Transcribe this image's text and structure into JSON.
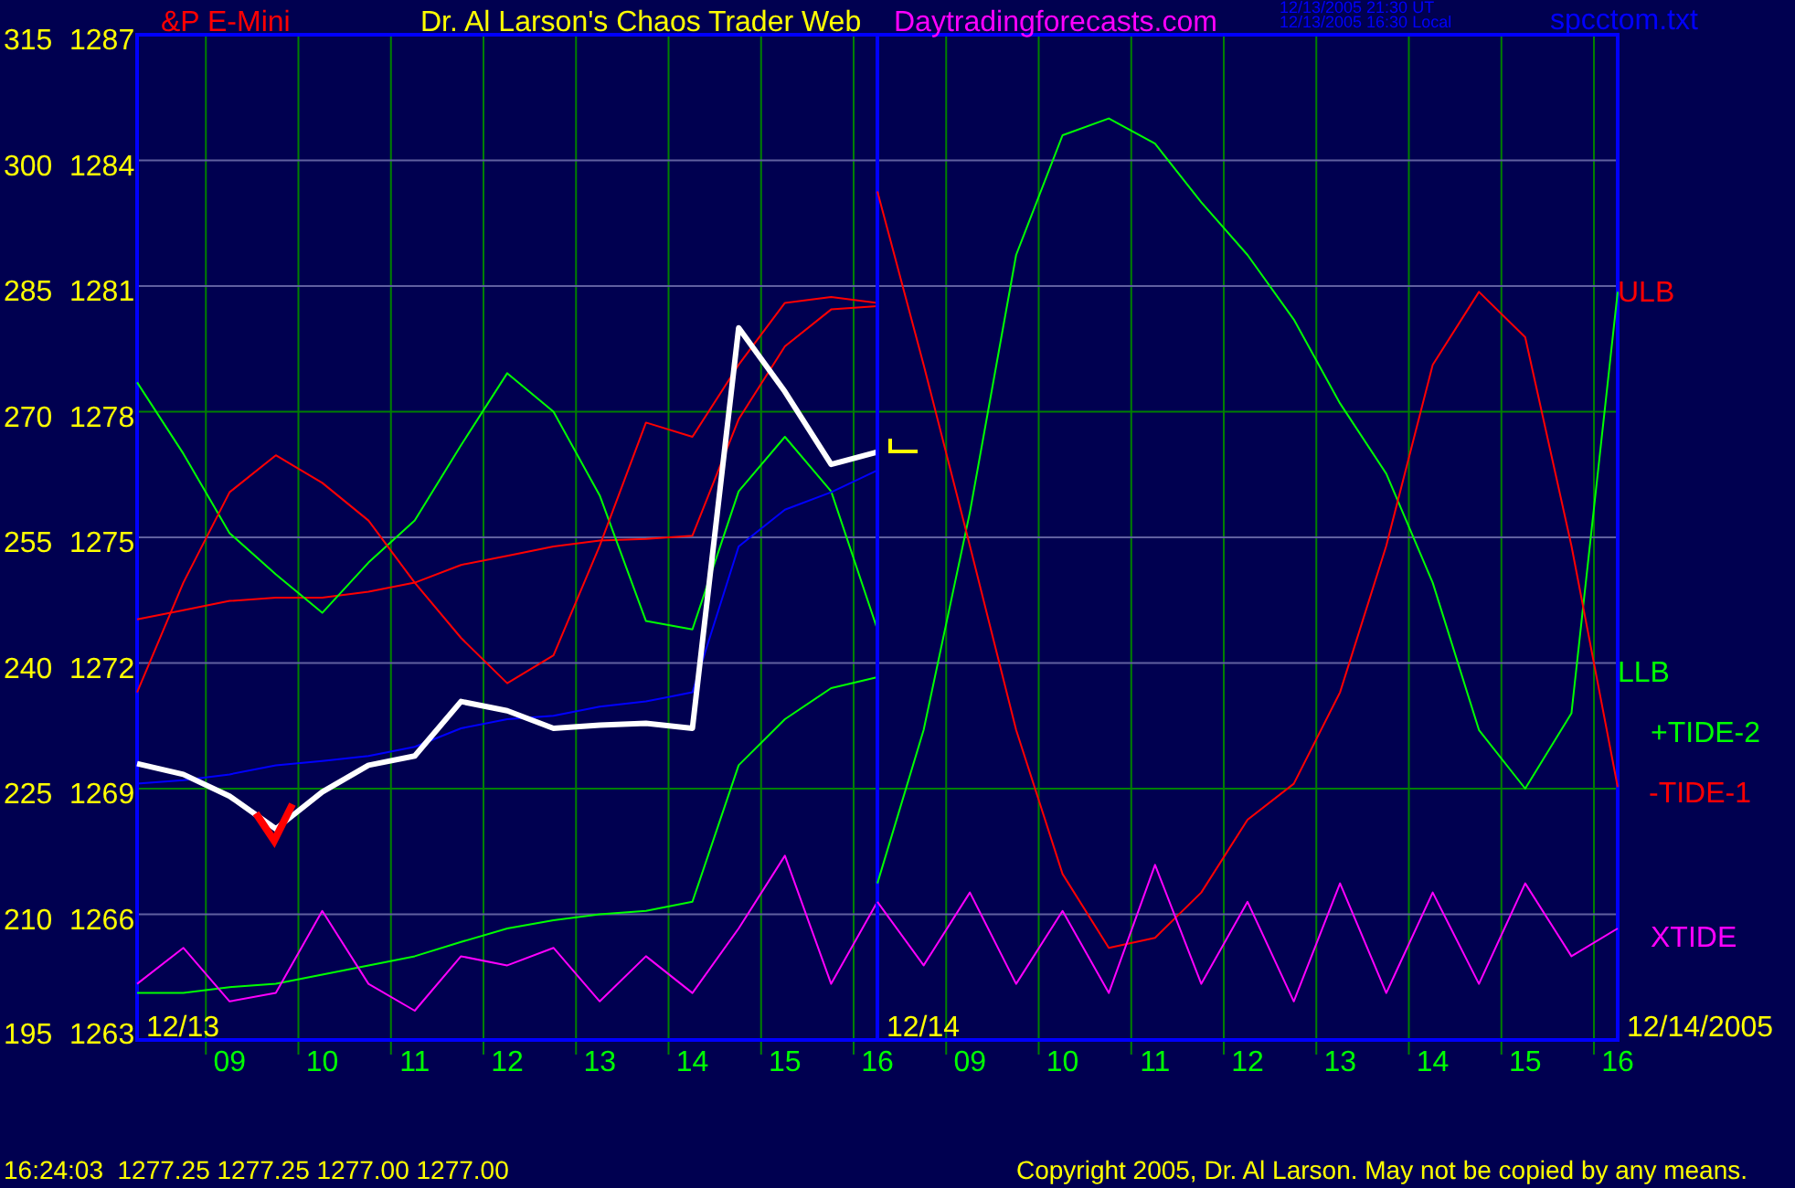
{
  "header": {
    "instrument": "&P E-Mini",
    "title": "Dr. Al Larson's Chaos Trader Web",
    "site": "Daytradingforecasts.com",
    "timestamps": [
      "12/13/2005 21:30 UT",
      "12/13/2005 16:30 Local"
    ],
    "file": "spcctom.txt"
  },
  "right_scale": [
    "1287",
    "1284",
    "1281",
    "1278",
    "1275",
    "1272",
    "1269",
    "1266",
    "1263"
  ],
  "legend": [
    {
      "label": "ULB",
      "color": "#ff0000"
    },
    {
      "label": "LLB",
      "color": "#00ff00"
    },
    {
      "label": "+TIDE-2",
      "color": "#00ff00"
    },
    {
      "label": "-TIDE-1",
      "color": "#ff0000"
    },
    {
      "label": "XTIDE",
      "color": "#ff00ff"
    }
  ],
  "panels": [
    {
      "date": "12/13",
      "chart_data": {
        "type": "line",
        "x": [
          8,
          8.5,
          9,
          9.5,
          10,
          10.5,
          11,
          11.5,
          12,
          12.5,
          13,
          13.5,
          14,
          14.5,
          15,
          15.5,
          16
        ],
        "xlim": [
          8,
          16
        ],
        "ylim": [
          195,
          315
        ],
        "grid": true,
        "xticks": [
          {
            "value": 9,
            "label": "09"
          },
          {
            "value": 10,
            "label": "10"
          },
          {
            "value": 11,
            "label": "11"
          },
          {
            "value": 12,
            "label": "12"
          },
          {
            "value": 13,
            "label": "13"
          },
          {
            "value": 14,
            "label": "14"
          },
          {
            "value": 15,
            "label": "15"
          },
          {
            "value": 16,
            "label": "16"
          }
        ],
        "yticks": [
          315,
          300,
          285,
          270,
          255,
          240,
          225,
          210,
          195
        ],
        "series": [
          {
            "color": "#ff0000",
            "values": [
              245.2,
              246.3,
              247.4,
              247.8,
              247.8,
              248.5,
              249.6,
              251.7,
              252.8,
              253.9,
              254.6,
              254.8,
              255.2,
              269.1,
              277.8,
              282.2,
              282.6
            ]
          },
          {
            "color": "#00ff00",
            "values": [
              200.6,
              200.6,
              201.3,
              201.7,
              202.8,
              203.9,
              205,
              206.7,
              208.3,
              209.3,
              210,
              210.4,
              211.5,
              227.8,
              233.3,
              237,
              238.3
            ]
          },
          {
            "color": "#00ff00",
            "values": [
              273.5,
              265,
              255.5,
              250.6,
              246,
              252,
              257,
              266,
              274.6,
              270,
              260,
              245,
              244,
              260.5,
              267,
              260.5,
              244
            ]
          },
          {
            "color": "#ff0000",
            "values": [
              236.5,
              249.6,
              260.4,
              264.8,
              261.5,
              257,
              249.6,
              243,
              237.6,
              240.9,
              254,
              268.7,
              267,
              275.6,
              283,
              283.7,
              283
            ]
          },
          {
            "color": "#ff00ff",
            "values": [
              201.7,
              206,
              199.6,
              200.6,
              210.4,
              201.7,
              198.5,
              205,
              203.9,
              206,
              199.6,
              205,
              200.6,
              208.3,
              217,
              201.7,
              211.5
            ]
          },
          {
            "color": "#0000ff",
            "values": [
              225.6,
              226,
              226.7,
              227.8,
              228.3,
              228.9,
              230,
              232.2,
              233.3,
              233.7,
              234.8,
              235.4,
              236.5,
              253.9,
              258.3,
              260.4,
              263
            ]
          },
          {
            "color": "#ffffff",
            "values": [
              228,
              226.7,
              224.1,
              220.2,
              224.6,
              227.8,
              228.9,
              235.4,
              234.3,
              232.2,
              232.6,
              232.8,
              232.2,
              280,
              272.4,
              263.7,
              265.2
            ]
          }
        ]
      }
    },
    {
      "date": "12/14",
      "chart_data": {
        "type": "line",
        "x": [
          8,
          8.5,
          9,
          9.5,
          10,
          10.5,
          11,
          11.5,
          12,
          12.5,
          13,
          13.5,
          14,
          14.5,
          15,
          15.5,
          16
        ],
        "xlim": [
          8,
          16
        ],
        "ylim": [
          195,
          315
        ],
        "grid": true,
        "xticks": [
          {
            "value": 9,
            "label": "09"
          },
          {
            "value": 10,
            "label": "10"
          },
          {
            "value": 11,
            "label": "11"
          },
          {
            "value": 12,
            "label": "12"
          },
          {
            "value": 13,
            "label": "13"
          },
          {
            "value": 14,
            "label": "14"
          },
          {
            "value": 15,
            "label": "15"
          },
          {
            "value": 16,
            "label": "16"
          }
        ],
        "series": [
          {
            "color": "#00ff00",
            "values": [
              213.7,
              232,
              258,
              288.7,
              303,
              305,
              302,
              295,
              288.7,
              281,
              271,
              262.6,
              249.6,
              232,
              225,
              234,
              284.3
            ]
          },
          {
            "color": "#ff0000",
            "values": [
              296.3,
              275.6,
              254,
              232,
              214.8,
              206,
              207.2,
              212.6,
              221.3,
              225.6,
              236.5,
              254,
              275.6,
              284.3,
              278.9,
              254,
              225.2
            ]
          },
          {
            "color": "#ff00ff",
            "values": [
              211.5,
              203.9,
              212.6,
              201.7,
              210.4,
              200.6,
              215.9,
              201.7,
              211.5,
              199.6,
              213.7,
              200.6,
              212.6,
              201.7,
              213.7,
              205,
              208.3
            ]
          }
        ]
      }
    }
  ],
  "end_date": "12/14/2005",
  "status_bar": {
    "quote": "16:24:03  1277.25 1277.25 1277.00 1277.00",
    "copyright": "Copyright 2005, Dr. Al Larson. May not be copied by any means."
  }
}
